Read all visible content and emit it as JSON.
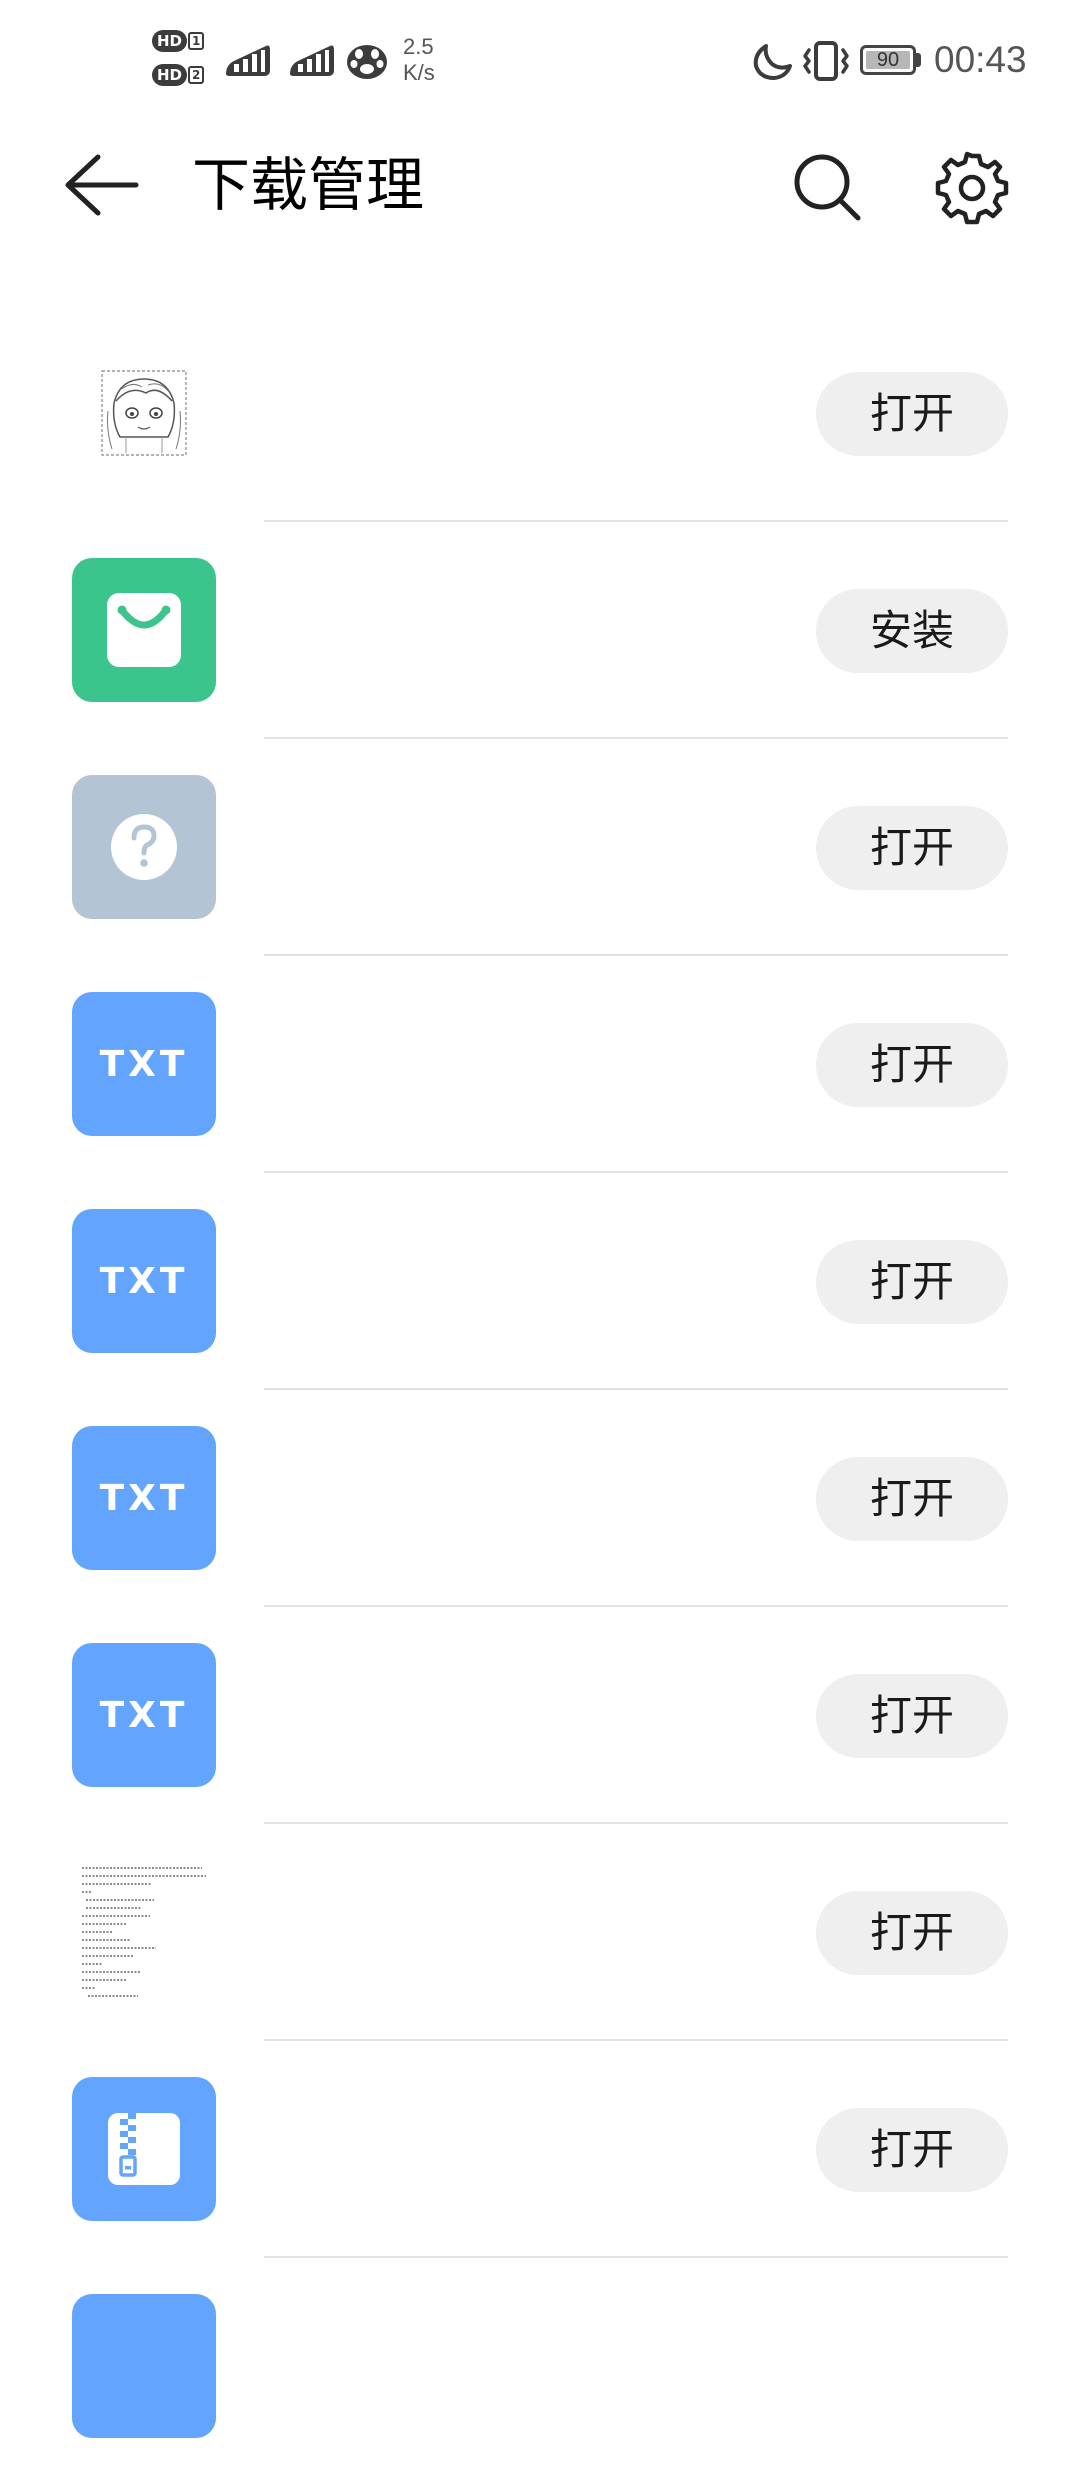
{
  "status_bar": {
    "hd1_label": "HD",
    "hd1_number": "1",
    "hd2_label": "HD",
    "hd2_number": "2",
    "net_speed_value": "2.5",
    "net_speed_unit": "K/s",
    "battery_level": "90",
    "time": "00:43",
    "icons": [
      "hd-badge-icon",
      "signal-icon",
      "signal-icon",
      "paw-icon",
      "moon-icon",
      "vibrate-icon",
      "battery-icon"
    ]
  },
  "header": {
    "title": "下载管理",
    "back_icon": "arrow-left-icon",
    "search_icon": "search-icon",
    "settings_icon": "gear-icon"
  },
  "downloads": {
    "items": [
      {
        "thumb": "manga-image-thumbnail",
        "action": "打开"
      },
      {
        "thumb": "shopping-bag-app-icon",
        "action": "安装"
      },
      {
        "thumb": "unknown-file-icon",
        "action": "打开"
      },
      {
        "thumb": "txt-file-icon",
        "thumb_text": "TXT",
        "action": "打开"
      },
      {
        "thumb": "txt-file-icon",
        "thumb_text": "TXT",
        "action": "打开"
      },
      {
        "thumb": "txt-file-icon",
        "thumb_text": "TXT",
        "action": "打开"
      },
      {
        "thumb": "txt-file-icon",
        "thumb_text": "TXT",
        "action": "打开"
      },
      {
        "thumb": "document-page-thumbnail",
        "action": "打开"
      },
      {
        "thumb": "zip-file-icon",
        "action": "打开"
      },
      {
        "thumb": "file-icon"
      }
    ]
  },
  "colors": {
    "green_app": "#3cc48d",
    "grey_unknown": "#b3c4d4",
    "blue_file": "#62a4fe",
    "button_bg": "#efefef",
    "divider": "#e3e3e3"
  }
}
